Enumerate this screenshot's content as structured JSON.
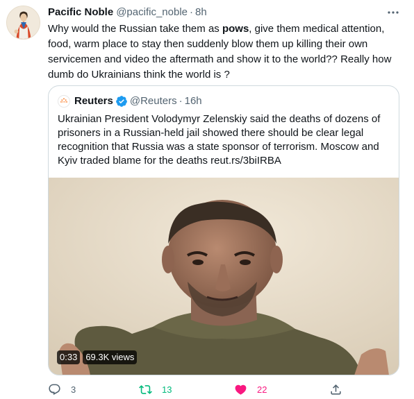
{
  "tweet": {
    "author_name": "Pacific Noble",
    "author_handle": "@pacific_noble",
    "separator": "·",
    "time": "8h",
    "text_before": "Why would the Russian take them as ",
    "text_bold": "pows",
    "text_after": ", give them medical attention, food, warm place to stay then suddenly blow them up killing their own servicemen and video the aftermath and show it to the world?? Really how dumb do Ukrainians think the world is ?"
  },
  "quote": {
    "author_name": "Reuters",
    "author_handle": "@Reuters",
    "separator": "·",
    "time": "16h",
    "text": "Ukrainian President Volodymyr Zelenskiy said the deaths of dozens of prisoners in a Russian-held jail showed there should be clear legal recognition that Russia was a state sponsor of terrorism. Moscow and Kyiv traded blame for the deaths reut.rs/3biIRBA",
    "video": {
      "duration": "0:33",
      "views": "69.3K views"
    }
  },
  "actions": {
    "reply_count": "3",
    "retweet_count": "13",
    "like_count": "22"
  },
  "colors": {
    "text": "#0f1419",
    "secondary": "#536471",
    "border": "#cfd9de",
    "verified": "#1d9bf0",
    "retweet": "#00ba7c",
    "like": "#f91880"
  },
  "icons": {
    "more": "more-horizontal-icon",
    "verified": "verified-badge-icon",
    "reply": "reply-icon",
    "retweet": "retweet-icon",
    "like": "heart-filled-icon",
    "share": "share-icon"
  }
}
